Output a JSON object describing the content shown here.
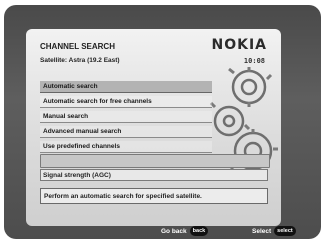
{
  "header": {
    "brand": "NOKIA",
    "time": "10:08",
    "title": "CHANNEL SEARCH",
    "subtitle": "Satellite: Astra (19.2 East)"
  },
  "menu": {
    "items": [
      {
        "label": "Automatic search",
        "selected": true
      },
      {
        "label": "Automatic search for free channels",
        "selected": false
      },
      {
        "label": "Manual search",
        "selected": false
      },
      {
        "label": "Advanced manual search",
        "selected": false
      },
      {
        "label": "Use predefined channels",
        "selected": false
      }
    ]
  },
  "signal": {
    "label": "Signal strength (AGC)",
    "level": 0
  },
  "help": {
    "text": "Perform an automatic search for specified satellite."
  },
  "footer": {
    "back_label": "Go back",
    "back_key": "back",
    "select_label": "Select",
    "select_key": "select"
  },
  "icons": [
    "gear-icon"
  ]
}
